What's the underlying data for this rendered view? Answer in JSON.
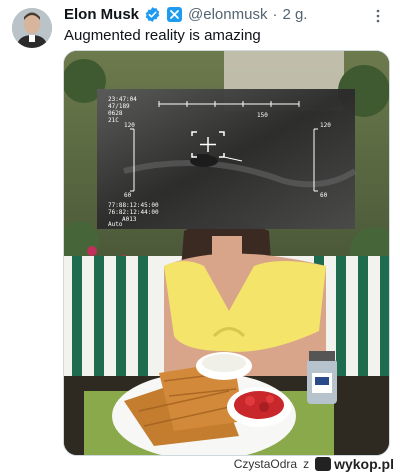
{
  "tweet": {
    "author_name": "Elon Musk",
    "handle": "@elonmusk",
    "separator": "·",
    "time": "2 g.",
    "text": "Augmented reality is amazing"
  },
  "hud": {
    "top_left": [
      "23:47:04",
      "47/189",
      "0628",
      "21C"
    ],
    "heading": "150",
    "left_scale_top": "120",
    "left_scale_bottom": "60",
    "right_scale_top": "120",
    "right_scale_bottom": "60",
    "bottom_left": [
      "77:88:12:45:00",
      "76:82:12:44:00",
      "A013"
    ],
    "mode": "Auto"
  },
  "footer": {
    "user": "CzystaOdra",
    "connector": "z",
    "brand": "wykop.pl"
  },
  "colors": {
    "verified_blue": "#1d9bf0",
    "text_primary": "#0f1419",
    "text_secondary": "#536471"
  }
}
